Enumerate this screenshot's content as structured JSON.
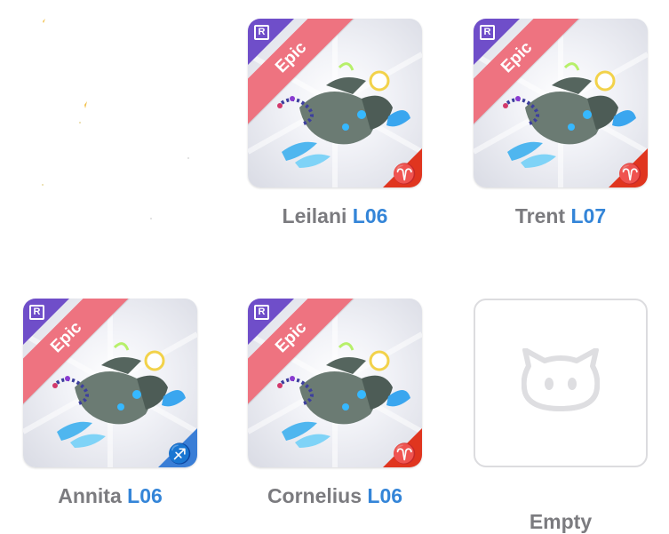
{
  "colors": {
    "epic_ribbon": "#ee7380",
    "rarity_corner": "#6f4ec9",
    "aries_corner": "#e0351f",
    "sagittarius_corner": "#3a7ed6",
    "name_text": "#7b7b7f",
    "level_text": "#3485d8"
  },
  "pets": [
    {
      "rarity_letter": "R",
      "rarity": "Epic",
      "name": "Leilani",
      "level": "L06",
      "zodiac": "♈",
      "zodiac_icon": "aries-icon"
    },
    {
      "rarity_letter": "R",
      "rarity": "Epic",
      "name": "Trent",
      "level": "L07",
      "zodiac": "♈",
      "zodiac_icon": "aries-icon"
    },
    {
      "rarity_letter": "R",
      "rarity": "Epic",
      "name": "Annita",
      "level": "L06",
      "zodiac": "♐",
      "zodiac_icon": "sagittarius-icon"
    },
    {
      "rarity_letter": "R",
      "rarity": "Epic",
      "name": "Cornelius",
      "level": "L06",
      "zodiac": "♈",
      "zodiac_icon": "aries-icon"
    }
  ],
  "empty_slot": {
    "label": "Empty",
    "icon": "cat-face-placeholder-icon"
  }
}
